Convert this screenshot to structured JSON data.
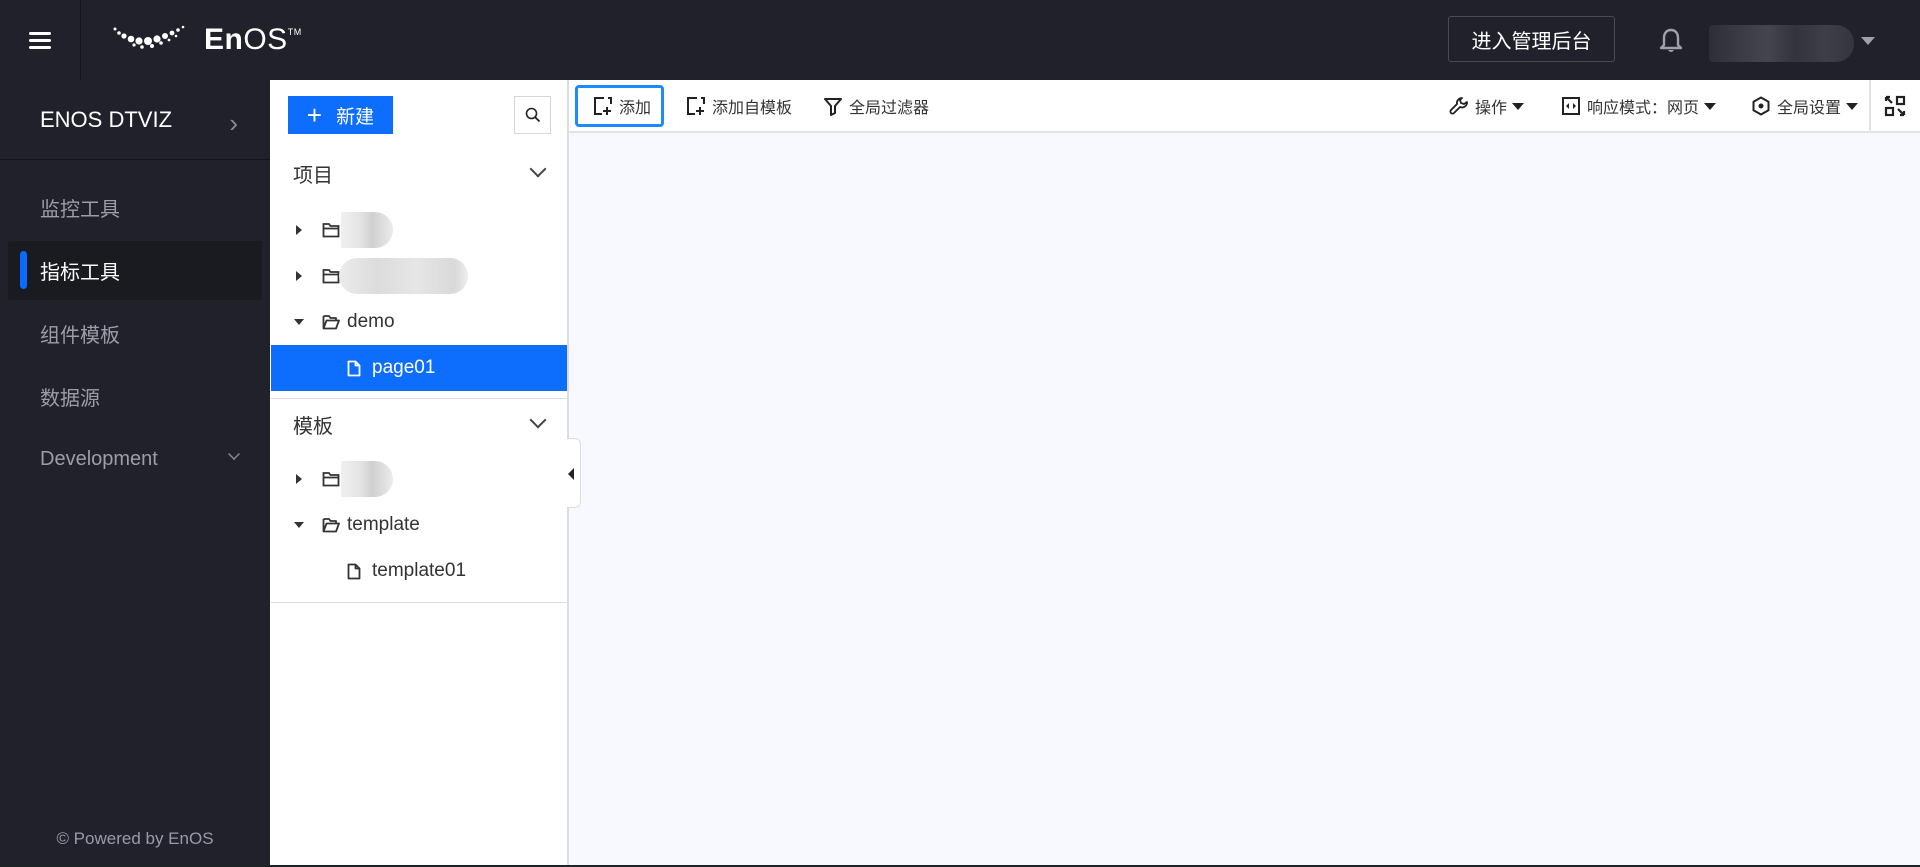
{
  "topbar": {
    "menu_icon": "hamburger-icon",
    "logo": {
      "brand_bold": "En",
      "brand_light": "OS",
      "trademark": "TM"
    },
    "admin_button": "进入管理后台",
    "notification_icon": "bell-icon",
    "user_menu_icon": "caret-down-icon"
  },
  "sidebar": {
    "app_title": "ENOS DTVIZ",
    "items": [
      {
        "label": "监控工具",
        "active": false
      },
      {
        "label": "指标工具",
        "active": true
      },
      {
        "label": "组件模板",
        "active": false
      },
      {
        "label": "数据源",
        "active": false
      },
      {
        "label": "Development",
        "active": false,
        "expandable": true
      }
    ],
    "footer": "© Powered by EnOS"
  },
  "panel": {
    "new_button": "新建",
    "search_icon": "search-icon",
    "projects": {
      "title": "项目",
      "nodes": [
        {
          "type": "folder",
          "label": "",
          "expanded": false,
          "redacted": true
        },
        {
          "type": "folder",
          "label": "",
          "expanded": false,
          "redacted": true
        },
        {
          "type": "folder",
          "label": "demo",
          "expanded": true
        },
        {
          "type": "file",
          "label": "page01",
          "selected": true
        }
      ]
    },
    "templates": {
      "title": "模板",
      "nodes": [
        {
          "type": "folder",
          "label": "",
          "expanded": false,
          "redacted": true
        },
        {
          "type": "folder",
          "label": "template",
          "expanded": true
        },
        {
          "type": "file",
          "label": "template01",
          "selected": false
        }
      ]
    }
  },
  "toolbar": {
    "add": "添加",
    "add_from_template": "添加自模板",
    "global_filter": "全局过滤器",
    "operations": "操作",
    "responsive_mode": "响应模式：网页",
    "global_settings": "全局设置",
    "fullscreen_icon": "fullscreen-icon"
  },
  "colors": {
    "primary": "#0d6efd",
    "topbar_bg": "#21212b",
    "canvas_bg": "#f8f9fe",
    "focus_outline": "#1a8cff"
  }
}
